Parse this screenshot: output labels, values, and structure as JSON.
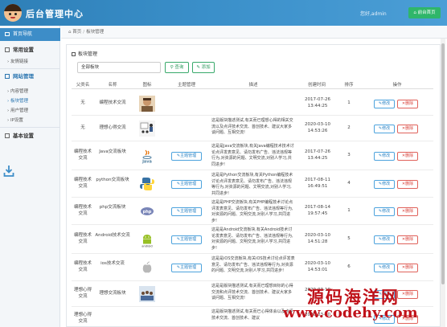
{
  "header": {
    "title": "后台管理中心",
    "welcome": "您好,admin",
    "home_button": "前台首页"
  },
  "sidebar": {
    "home": "首页导航",
    "sections": [
      {
        "label": "常用设置",
        "items": [
          {
            "label": "友情链接"
          }
        ]
      },
      {
        "label": "网站管理",
        "items": [
          {
            "label": "内容管理"
          },
          {
            "label": "板块管理"
          },
          {
            "label": "用户管理"
          },
          {
            "label": "IP设置"
          }
        ]
      },
      {
        "label": "基本设置",
        "items": []
      }
    ]
  },
  "breadcrumb": {
    "home": "首页",
    "current": "板块管理"
  },
  "panel": {
    "title": "板块管理",
    "filter_value": "全部板块",
    "search_button": "查询",
    "add_button": "添加"
  },
  "table": {
    "headers": [
      "父类名",
      "名称",
      "图标",
      "主题管理",
      "描述",
      "创建时间",
      "排序",
      "操作"
    ],
    "manage_label": "主题管理",
    "edit_label": "修改",
    "delete_label": "删除",
    "rows": [
      {
        "parent": "无",
        "name": "编程技术交流",
        "icon": "person-avatar-icon",
        "manage": false,
        "desc": "",
        "date": "2017-07-26",
        "time": "13:44:25",
        "order": "1"
      },
      {
        "parent": "无",
        "name": "理想心得交流",
        "icon": "classroom-icon",
        "manage": false,
        "desc": "这是版块描述测试,有关而已理想心得的相关交流以及点评技术交流、首创技术、建议大家多谈问题、互相交流!",
        "date": "2020-03-10",
        "time": "14:53:26",
        "order": "2"
      },
      {
        "parent": "编程技术交流",
        "name": "Java交流板块",
        "icon": "java-icon",
        "manage": true,
        "desc": "这是是Java交流板块,有关Java编程技术技术讨论点评发表意见、请勿发布广告、违法违规等行为,对资源的问题、文明交流,对别人学习,共同进步!",
        "date": "2017-07-26",
        "time": "13:44:25",
        "order": "3"
      },
      {
        "parent": "编程技术交流",
        "name": "python交流板块",
        "icon": "python-icon",
        "manage": true,
        "desc": "这是是Python交流板块,有关Python编程技术讨论点评发表意见、请勿发布广告、违法违规等行为,对资源的问题、文明交流,对别人学习,共同进步!",
        "date": "2017-08-11",
        "time": "16:49:51",
        "order": "4"
      },
      {
        "parent": "编程技术交流",
        "name": "php交流板块",
        "icon": "php-icon",
        "manage": true,
        "desc": "这是是PHP交流板块,有关PHP编程技术讨论点评发表意见、请勿发布广告、违法违规等行为,对资源的问题、文明交流,对别人学习,共同进步!",
        "date": "2017-08-14",
        "time": "19:57:45",
        "order": "1"
      },
      {
        "parent": "编程技术交流",
        "name": "Android技术交流",
        "icon": "android-icon",
        "manage": true,
        "desc": "这是是Android交流板块,有关Android技术讨论发表意见、请勿发布广告、违法违规等行为,对资源的问题、文明交流,对别人学习,共同进步!",
        "date": "2020-03-10",
        "time": "14:51:28",
        "order": "5"
      },
      {
        "parent": "编程技术交流",
        "name": "ios技术交流",
        "icon": "apple-icon",
        "manage": true,
        "desc": "这是是iOS交流板块,有关iOS技术讨论点评发表意见、请勿发布广告、违法违规等行为,对资源的问题、文明交流,对别人学习,共同进步!",
        "date": "2020-03-10",
        "time": "14:53:01",
        "order": "6"
      },
      {
        "parent": "理想心得交流",
        "name": "理想交流板块",
        "icon": "group-photo-icon",
        "manage": false,
        "desc": "这是是版块描述测试,有关而已理想目标的心得交流和点评技术交流、首创技术、建议大家多谈问题、互相交流!",
        "date": "2020-03-10",
        "time": "",
        "order": ""
      },
      {
        "parent": "理想心得交流",
        "name": "",
        "icon": "",
        "manage": false,
        "desc": "这是版块描述测试,有关而已心得体会以及点评技术交流、首创技术、建议",
        "date": "2020-03-10",
        "time": "",
        "order": ""
      }
    ]
  },
  "watermark": {
    "line1": "源码海洋网",
    "line2": "www.codehy.com"
  }
}
